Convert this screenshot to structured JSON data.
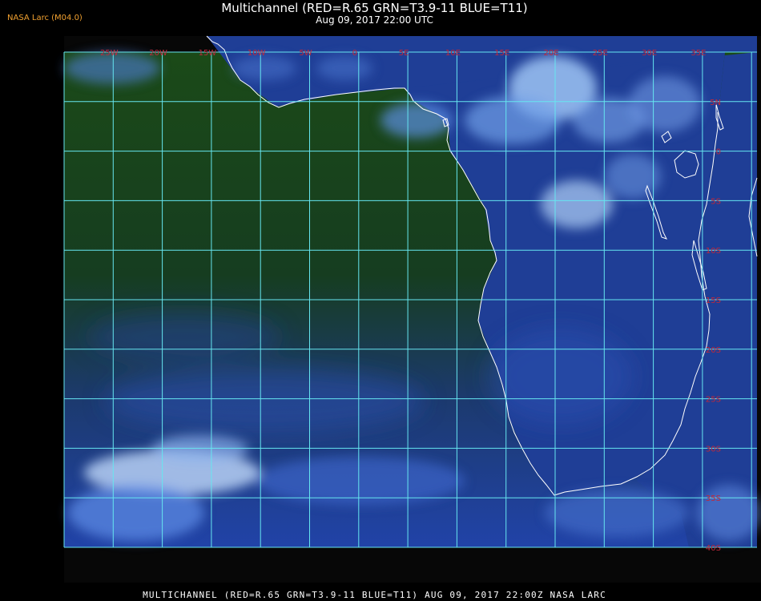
{
  "header": {
    "source_tag": "NASA Larc (M04.0)",
    "title": "Multichannel (RED=R.65 GRN=T3.9-11 BLUE=T11)",
    "subtitle": "Aug 09, 2017 22:00 UTC"
  },
  "footer": {
    "text": "MULTICHANNEL (RED=R.65 GRN=T3.9-11 BLUE=T11) AUG 09, 2017 22:00Z   NASA LARC"
  },
  "map": {
    "grid_color": "#66e6f0",
    "label_color": "#c0283a",
    "coast_color": "#ffffff",
    "ocean_color": "#163f14",
    "land_color": "#1f3f98",
    "longitude_labels": [
      "25W",
      "20W",
      "15W",
      "10W",
      "5W",
      "0",
      "5E",
      "10E",
      "15E",
      "20E",
      "25E",
      "30E",
      "35E"
    ],
    "latitude_labels": [
      "5N",
      "0",
      "5S",
      "10S",
      "15S",
      "20S",
      "25S",
      "30S",
      "35S",
      "40S"
    ]
  }
}
